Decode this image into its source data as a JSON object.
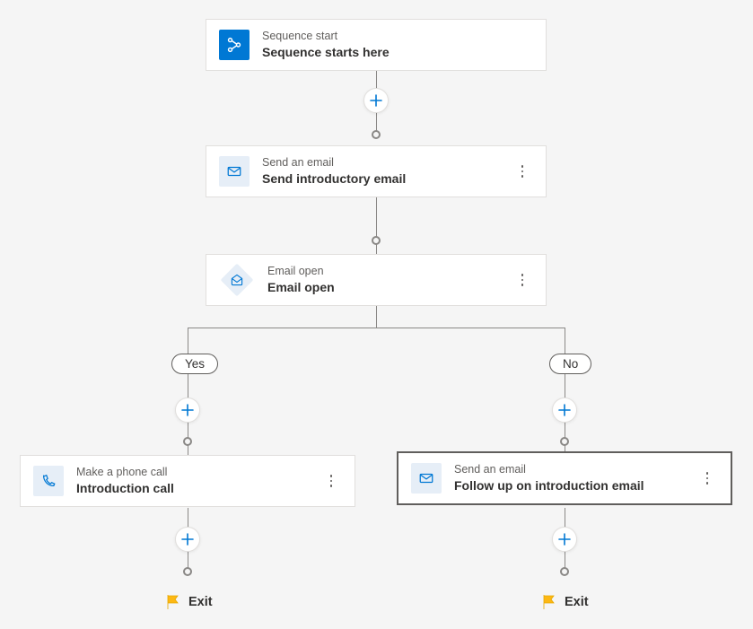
{
  "nodes": {
    "start": {
      "type": "Sequence start",
      "title": "Sequence starts here"
    },
    "email1": {
      "type": "Send an email",
      "title": "Send introductory email"
    },
    "cond": {
      "type": "Email open",
      "title": "Email open"
    },
    "call": {
      "type": "Make a phone call",
      "title": "Introduction call"
    },
    "email2": {
      "type": "Send an email",
      "title": "Follow up on introduction email"
    }
  },
  "branches": {
    "yes": "Yes",
    "no": "No"
  },
  "exit_label": "Exit",
  "colors": {
    "accent": "#0078d4",
    "flag": "#fdb813"
  }
}
